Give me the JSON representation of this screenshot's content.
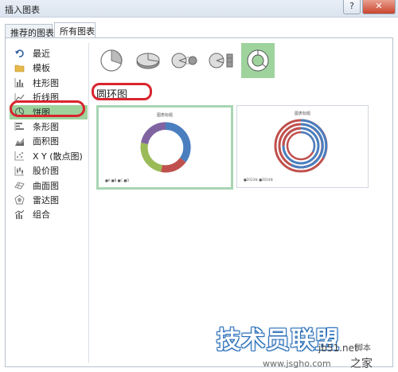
{
  "window": {
    "title": "插入图表",
    "help": "?",
    "close": "✕"
  },
  "tabs": [
    {
      "label": "推荐的图表"
    },
    {
      "label": "所有图表"
    }
  ],
  "sidebar": {
    "items": [
      {
        "label": "最近",
        "icon": "undo-icon"
      },
      {
        "label": "模板",
        "icon": "folder-icon"
      },
      {
        "label": "柱形图",
        "icon": "column-chart-icon"
      },
      {
        "label": "折线图",
        "icon": "line-chart-icon"
      },
      {
        "label": "饼图",
        "icon": "pie-chart-icon",
        "selected": true
      },
      {
        "label": "条形图",
        "icon": "bar-chart-icon"
      },
      {
        "label": "面积图",
        "icon": "area-chart-icon"
      },
      {
        "label": "X Y (散点图)",
        "icon": "scatter-chart-icon"
      },
      {
        "label": "股价图",
        "icon": "stock-chart-icon"
      },
      {
        "label": "曲面图",
        "icon": "surface-chart-icon"
      },
      {
        "label": "雷达图",
        "icon": "radar-chart-icon"
      },
      {
        "label": "组合",
        "icon": "combo-chart-icon"
      }
    ]
  },
  "section": {
    "title": "圆环图"
  },
  "previews": [
    {
      "title": "图表标题",
      "legend": "■A ■B ■C ■D"
    },
    {
      "title": "图表标题",
      "legend": "■2013年 ■2014年"
    }
  ],
  "watermark": {
    "text": "技术员联盟",
    "site": "jb51.net",
    "site2": "www.jsgho.com",
    "corner": "脚本",
    "jia": "之家"
  },
  "colors": {
    "selected": "#9fd39e",
    "highlight": "#d9252e",
    "blue": "#4a7ebf",
    "red": "#c0504d",
    "green": "#9bbb59",
    "purple": "#8064a2"
  }
}
